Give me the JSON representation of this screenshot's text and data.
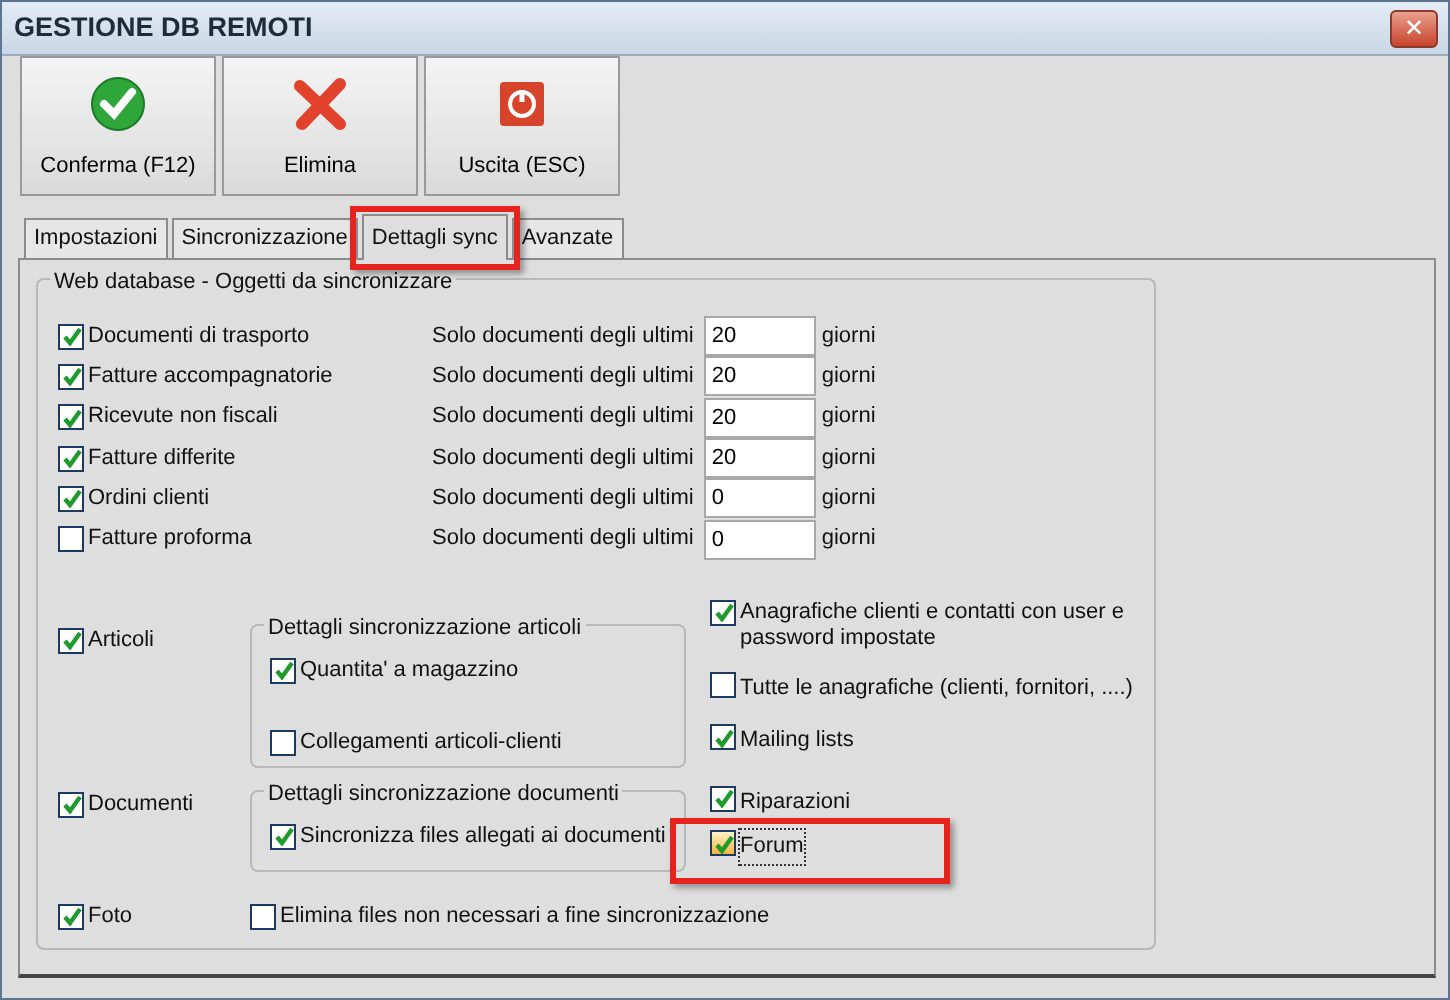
{
  "window": {
    "title": "GESTIONE DB REMOTI",
    "close": "✕"
  },
  "toolbar": [
    {
      "label": "Conferma (F12)",
      "kind": "confirm"
    },
    {
      "label": "Elimina",
      "kind": "delete"
    },
    {
      "label": "Uscita (ESC)",
      "kind": "exit"
    }
  ],
  "tabs": [
    {
      "label": "Impostazioni",
      "selected": false,
      "highlighted": false
    },
    {
      "label": "Sincronizzazione",
      "selected": false,
      "highlighted": false
    },
    {
      "label": "Dettagli sync",
      "selected": true,
      "highlighted": true
    },
    {
      "label": "Avanzate",
      "selected": false,
      "highlighted": false
    }
  ],
  "group": {
    "title": "Web database - Oggetti da sincronizzare",
    "documents": [
      {
        "label": "Documenti di trasporto",
        "checked": true,
        "prefix": "Solo documenti degli ultimi",
        "value": "20",
        "suffix": "giorni"
      },
      {
        "label": "Fatture accompagnatorie",
        "checked": true,
        "prefix": "Solo documenti degli ultimi",
        "value": "20",
        "suffix": "giorni"
      },
      {
        "label": "Ricevute non fiscali",
        "checked": true,
        "prefix": "Solo documenti degli ultimi",
        "value": "20",
        "suffix": "giorni"
      },
      {
        "label": "Fatture differite",
        "checked": true,
        "prefix": "Solo documenti degli ultimi",
        "value": "20",
        "suffix": "giorni"
      },
      {
        "label": "Ordini clienti",
        "checked": true,
        "prefix": "Solo documenti degli ultimi",
        "value": "0",
        "suffix": "giorni"
      },
      {
        "label": "Fatture proforma",
        "checked": false,
        "prefix": "Solo documenti degli ultimi",
        "value": "0",
        "suffix": "giorni"
      }
    ],
    "sections": [
      {
        "label": "Articoli",
        "checked": true,
        "details": {
          "title": "Dettagli sincronizzazione articoli",
          "options": [
            {
              "label": "Quantita' a magazzino",
              "checked": true
            },
            {
              "label": "Collegamenti articoli-clienti",
              "checked": false
            }
          ]
        },
        "options": [
          {
            "label": "Anagrafiche clienti e contatti con user e password impostate",
            "checked": true,
            "focused": false,
            "highlighted": false
          },
          {
            "label": "Tutte le anagrafiche (clienti, fornitori, ....)",
            "checked": false,
            "focused": false,
            "highlighted": false
          },
          {
            "label": "Mailing lists",
            "checked": true,
            "focused": false,
            "highlighted": false
          }
        ]
      },
      {
        "label": "Documenti",
        "checked": true,
        "details": {
          "title": "Dettagli sincronizzazione documenti",
          "options": [
            {
              "label": "Sincronizza files allegati ai documenti",
              "checked": true
            }
          ]
        },
        "options": [
          {
            "label": "Riparazioni",
            "checked": true,
            "focused": false,
            "highlighted": false
          },
          {
            "label": "Forum",
            "checked": true,
            "focused": true,
            "highlighted": true
          }
        ]
      }
    ],
    "foto": {
      "label": "Foto",
      "checked": true
    },
    "cleanup": {
      "label": "Elimina files non necessari a fine sincronizzazione",
      "checked": false
    }
  }
}
